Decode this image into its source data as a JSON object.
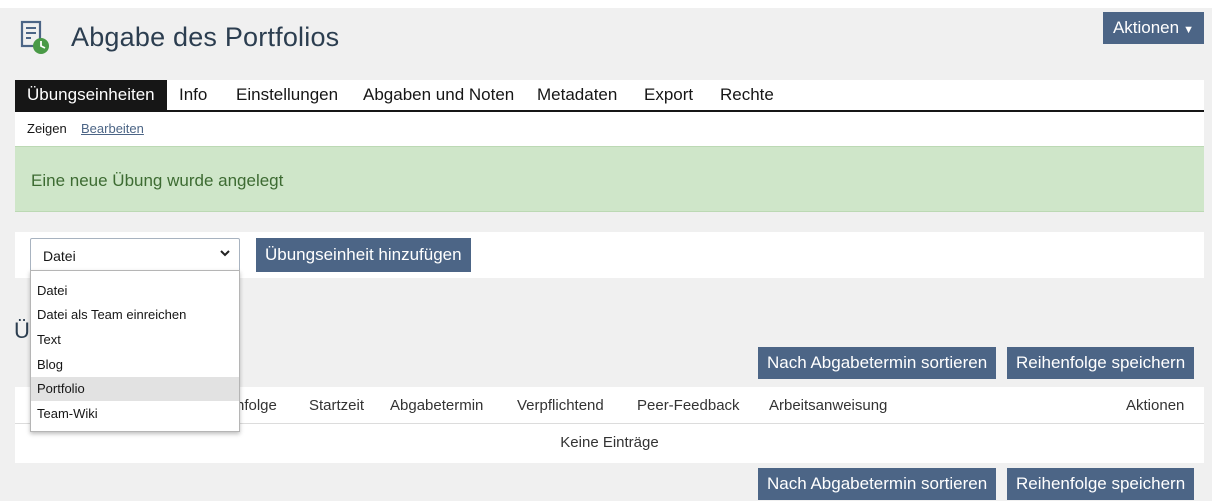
{
  "header": {
    "title": "Abgabe des Portfolios",
    "actions_label": "Aktionen",
    "icon": "exercise-icon"
  },
  "tabs": [
    {
      "label": "Übungseinheiten",
      "active": true
    },
    {
      "label": "Info"
    },
    {
      "label": "Einstellungen"
    },
    {
      "label": "Abgaben und Noten"
    },
    {
      "label": "Metadaten"
    },
    {
      "label": "Export"
    },
    {
      "label": "Rechte"
    }
  ],
  "subtabs": [
    {
      "label": "Zeigen"
    },
    {
      "label": "Bearbeiten"
    }
  ],
  "alert": {
    "message": "Eine neue Übung wurde angelegt"
  },
  "toolbar": {
    "select_value": "Datei",
    "add_button": "Übungseinheit hinzufügen"
  },
  "dropdown": {
    "options": [
      "Datei",
      "Datei als Team einreichen",
      "Text",
      "Blog",
      "Portfolio",
      "Team-Wiki"
    ],
    "highlighted": "Portfolio"
  },
  "section": {
    "heading_visible": "Ü"
  },
  "buttons": {
    "sort": "Nach Abgabetermin sortieren",
    "save_order": "Reihenfolge speichern"
  },
  "table": {
    "columns": [
      "nfolge",
      "Startzeit",
      "Abgabetermin",
      "Verpflichtend",
      "Peer-Feedback",
      "Arbeitsanweisung",
      "Aktionen"
    ],
    "empty_text": "Keine Einträge"
  },
  "colors": {
    "primary_button": "#4c6586",
    "success_bg": "#cfe6c9",
    "tab_active": "#161616"
  }
}
